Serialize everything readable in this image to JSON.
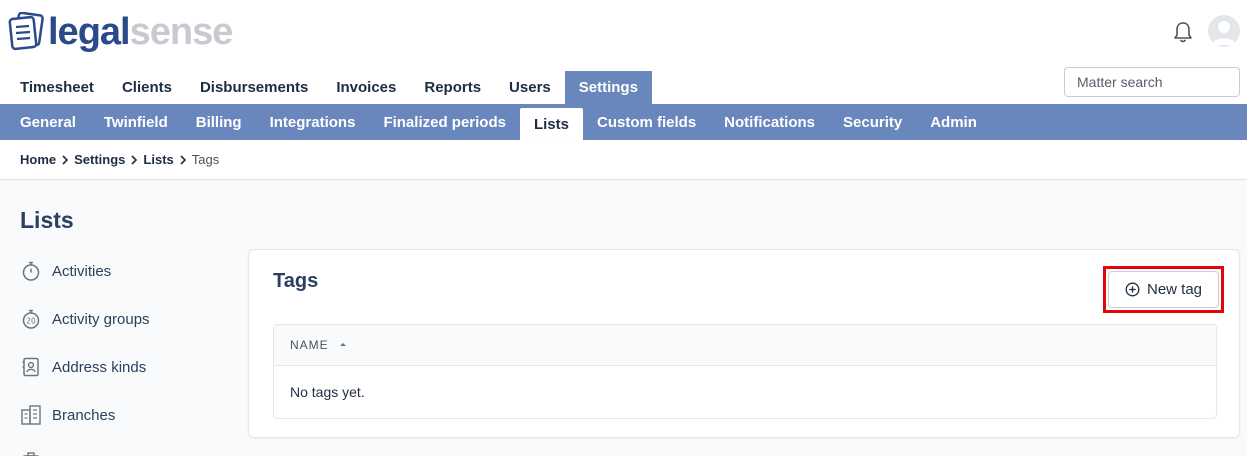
{
  "brand": {
    "legal": "legal",
    "sense": "sense"
  },
  "main_nav": [
    {
      "label": "Timesheet",
      "active": false
    },
    {
      "label": "Clients",
      "active": false
    },
    {
      "label": "Disbursements",
      "active": false
    },
    {
      "label": "Invoices",
      "active": false
    },
    {
      "label": "Reports",
      "active": false
    },
    {
      "label": "Users",
      "active": false
    },
    {
      "label": "Settings",
      "active": true
    }
  ],
  "search": {
    "placeholder": "Matter search",
    "value": ""
  },
  "sub_nav": [
    {
      "label": "General",
      "active": false
    },
    {
      "label": "Twinfield",
      "active": false
    },
    {
      "label": "Billing",
      "active": false
    },
    {
      "label": "Integrations",
      "active": false
    },
    {
      "label": "Finalized periods",
      "active": false
    },
    {
      "label": "Lists",
      "active": true
    },
    {
      "label": "Custom fields",
      "active": false
    },
    {
      "label": "Notifications",
      "active": false
    },
    {
      "label": "Security",
      "active": false
    },
    {
      "label": "Admin",
      "active": false
    }
  ],
  "breadcrumb": [
    "Home",
    "Settings",
    "Lists",
    "Tags"
  ],
  "page": {
    "title": "Lists"
  },
  "sidebar": [
    {
      "label": "Activities",
      "icon": "stopwatch-icon"
    },
    {
      "label": "Activity groups",
      "icon": "stopwatch-20-icon"
    },
    {
      "label": "Address kinds",
      "icon": "contact-card-icon"
    },
    {
      "label": "Branches",
      "icon": "buildings-icon"
    }
  ],
  "tags_card": {
    "title": "Tags",
    "new_button": "New tag",
    "column_header": "NAME",
    "empty_message": "No tags yet."
  },
  "colors": {
    "nav_accent": "#6a87bd",
    "highlight": "#e0060c",
    "brand_dark": "#2b4a8a"
  }
}
